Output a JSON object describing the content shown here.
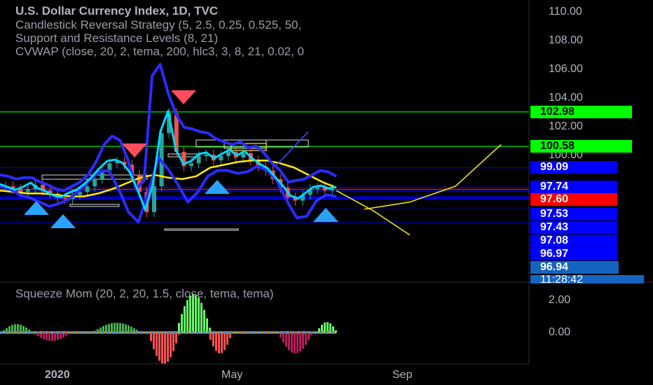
{
  "legend": {
    "title": "U.S. Dollar Currency Index, 1D, TVC",
    "line2": "Candlestick Reversal Strategy (5, 2.5, 0.25, 0.525, 50,",
    "line3": "Support and Resistance Levels (8, 21)",
    "line4": "CVWAP (close, 20, 2, tema, 200, hlc3, 3, 8, 21, 0.02, 0",
    "sub": "Squeeze Mom (20, 2, 20, 1.5, close, tema, tema)"
  },
  "colors": {
    "background": "#000000",
    "green_level": "#00e600",
    "blue_level": "#0000ff",
    "red_label": "#ff0000",
    "clock_label": "#1565c0",
    "forecast": "#ffee00",
    "envelope": "#2b2bff",
    "cyan": "#00d8ff",
    "up_candle": "#26a69a",
    "down_candle": "#ef5350"
  },
  "price_labels": [
    {
      "text": "102.98",
      "value": 102.98,
      "bg": "#00ff00",
      "fg": "#000000"
    },
    {
      "text": "100.58",
      "value": 100.58,
      "bg": "#00ff00",
      "fg": "#000000"
    },
    {
      "text": "99.09",
      "value": 99.09,
      "bg": "#0000ff",
      "fg": "#ffffff"
    },
    {
      "text": "97.74",
      "value": 97.74,
      "bg": "#0000ff",
      "fg": "#ffffff"
    },
    {
      "text": "97.60",
      "value": 97.6,
      "bg": "#ff0000",
      "fg": "#ffffff"
    },
    {
      "text": "97.53",
      "value": 97.53,
      "bg": "#0000ff",
      "fg": "#ffffff"
    },
    {
      "text": "97.43",
      "value": 97.43,
      "bg": "#0000ff",
      "fg": "#ffffff"
    },
    {
      "text": "97.08",
      "value": 97.08,
      "bg": "#0000ff",
      "fg": "#ffffff"
    },
    {
      "text": "96.97",
      "value": 96.97,
      "bg": "#0000ff",
      "fg": "#ffffff"
    },
    {
      "text": "96.94",
      "value": 96.94,
      "bg": "#1565c0",
      "fg": "#ffffff"
    },
    {
      "text": "11:28:42",
      "value": null,
      "bg": "#1565c0",
      "fg": "#ffffff"
    }
  ],
  "chart_data": {
    "type": "line",
    "title": "U.S. Dollar Currency Index, 1D, TVC",
    "x_ticks": [
      "2020",
      "May",
      "Sep"
    ],
    "y_ticks": [
      "110.00",
      "108.00",
      "106.00",
      "104.00",
      "102.00",
      "100.00"
    ],
    "sub_y_ticks": [
      "2.00",
      "0.00"
    ],
    "ylim": [
      94.5,
      110.5
    ],
    "series": [
      {
        "values": [
          97.8,
          97.6,
          97.4,
          97.6,
          97.9,
          97.5,
          97.3,
          97.0,
          96.9,
          97.2,
          97.4,
          97.8,
          98.3,
          98.9,
          99.4,
          99.5,
          99.3,
          98.6,
          97.4,
          96.0,
          97.8,
          101.5,
          102.9,
          100.2,
          99.2,
          99.4,
          99.9,
          100.0,
          99.6,
          99.9,
          100.2,
          99.8,
          100.1,
          99.6,
          99.2,
          98.9,
          98.3,
          97.7,
          97.0,
          96.8,
          97.2,
          97.6,
          97.7,
          97.5,
          97.6
        ]
      },
      {
        "values": [
          98.6,
          98.5,
          98.3,
          98.4,
          98.4,
          98.1,
          97.9,
          97.6,
          97.5,
          97.8,
          98.1,
          98.6,
          99.5,
          100.7,
          101.3,
          101.0,
          99.6,
          97.6,
          98.2,
          105.5,
          106.3,
          104.3,
          102.8,
          101.9,
          101.8,
          101.6,
          101.5,
          101.1,
          100.9,
          100.7,
          100.9,
          100.5,
          100.6,
          100.1,
          99.4,
          98.9,
          98.1,
          98.2,
          98.3,
          98.6,
          98.9,
          98.8,
          98.5
        ]
      },
      {
        "values": [
          97.8,
          97.6,
          97.2,
          97.0,
          96.7,
          96.4,
          96.6,
          96.9,
          97.5,
          98.2,
          98.8,
          98.9,
          97.6,
          96.0,
          95.3,
          97.4,
          99.8,
          99.0,
          97.9,
          96.7,
          97.4,
          98.5,
          98.9,
          98.9,
          98.7,
          98.8,
          99.2,
          98.9,
          98.2,
          96.8,
          95.6,
          95.7,
          96.8,
          97.2,
          97.1
        ]
      },
      {
        "values": [
          97.5,
          97.4,
          97.3,
          97.3,
          97.2,
          97.1,
          97.1,
          97.3,
          97.6,
          98.0,
          98.4,
          98.6,
          98.4,
          98.3,
          98.5,
          99.1,
          99.3,
          99.5,
          99.6,
          99.6,
          99.4,
          99.1,
          98.6,
          98.1,
          97.7
        ]
      },
      {
        "values": [
          97.5,
          96.1,
          94.4
        ]
      },
      {
        "values": [
          96.2,
          96.7,
          97.8,
          100.7
        ]
      }
    ],
    "annotations": {
      "levels": [
        102.98,
        100.58,
        99.09,
        97.74,
        97.6,
        97.53,
        97.43,
        97.08,
        96.97,
        96.94
      ]
    }
  }
}
